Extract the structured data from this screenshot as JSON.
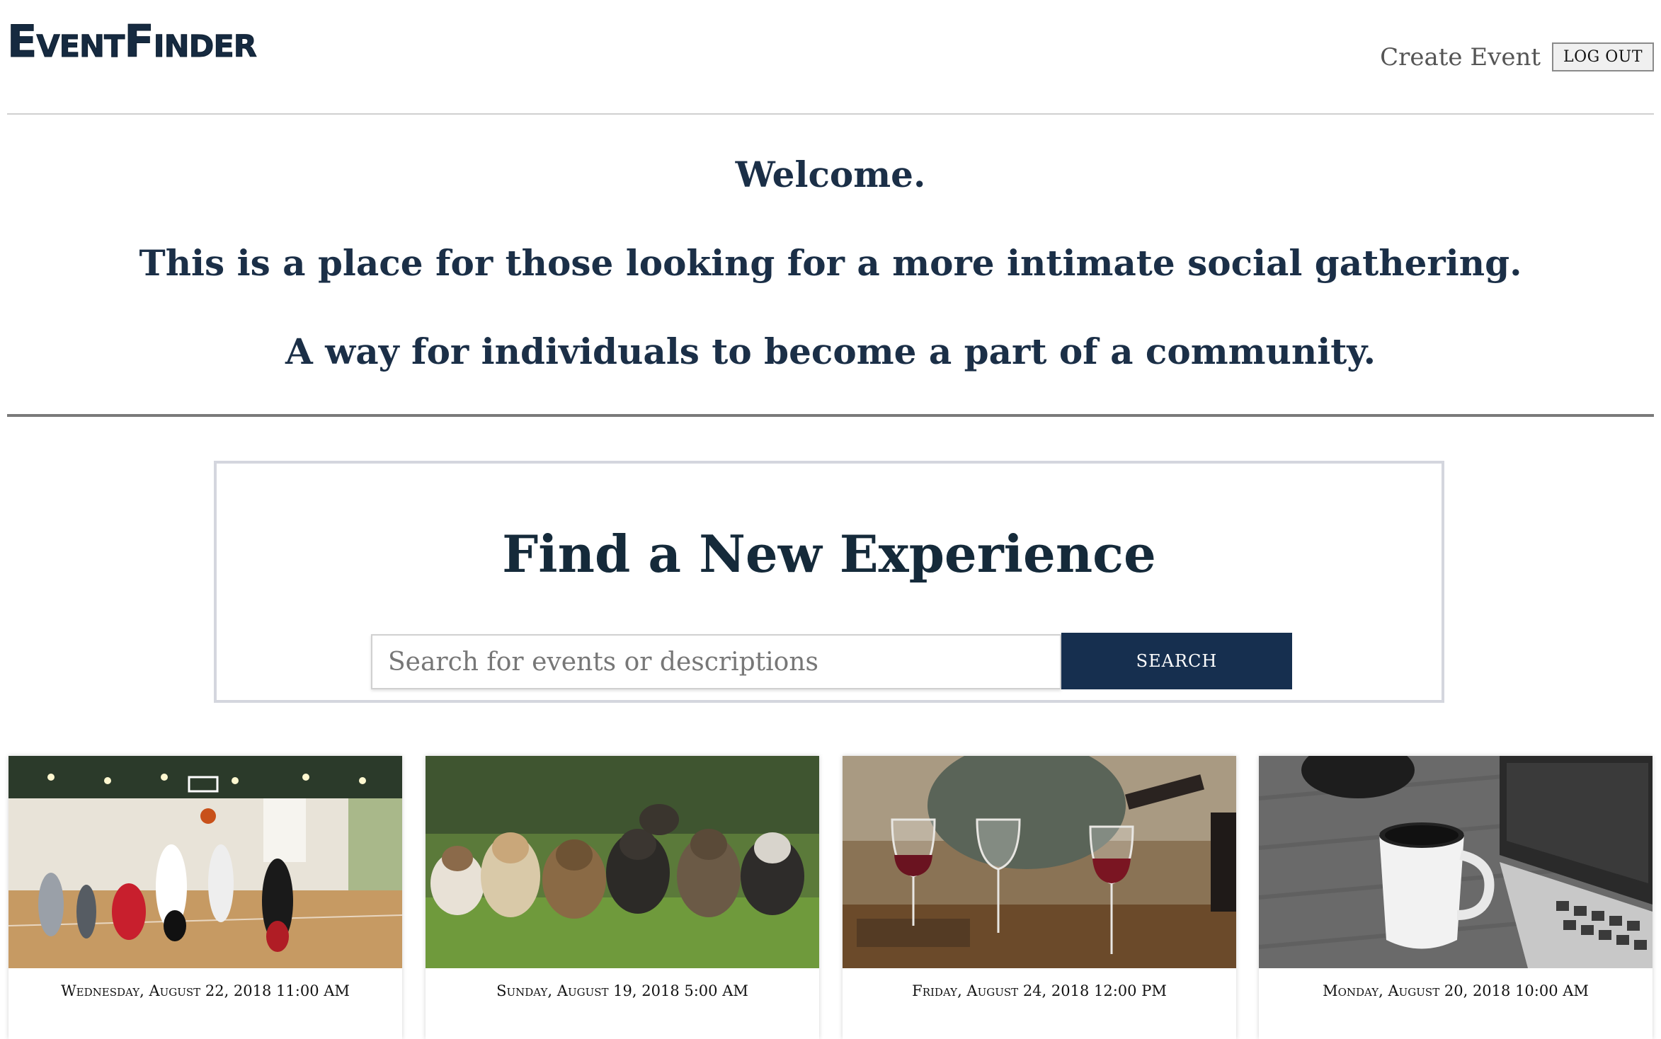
{
  "header": {
    "logo": "EventFinder",
    "nav": {
      "create_event": "Create Event",
      "logout": "LOG OUT"
    }
  },
  "welcome": {
    "line1": "Welcome.",
    "line2": "This is a place for those looking for a more intimate social gathering.",
    "line3": "A way for individuals to become a part of a community."
  },
  "search": {
    "title": "Find a New Experience",
    "placeholder": "Search for events or descriptions",
    "value": "",
    "button": "SEARCH"
  },
  "events": [
    {
      "date": "Wednesday, August 22, 2018 11:00 AM",
      "image": "basketball-photo"
    },
    {
      "date": "Sunday, August 19, 2018 5:00 AM",
      "image": "puppies-photo"
    },
    {
      "date": "Friday, August 24, 2018 12:00 PM",
      "image": "wine-glasses-photo"
    },
    {
      "date": "Monday, August 20, 2018 10:00 AM",
      "image": "coffee-laptop-photo"
    }
  ],
  "colors": {
    "navy": "#162f4f",
    "text": "#1b2f47"
  }
}
